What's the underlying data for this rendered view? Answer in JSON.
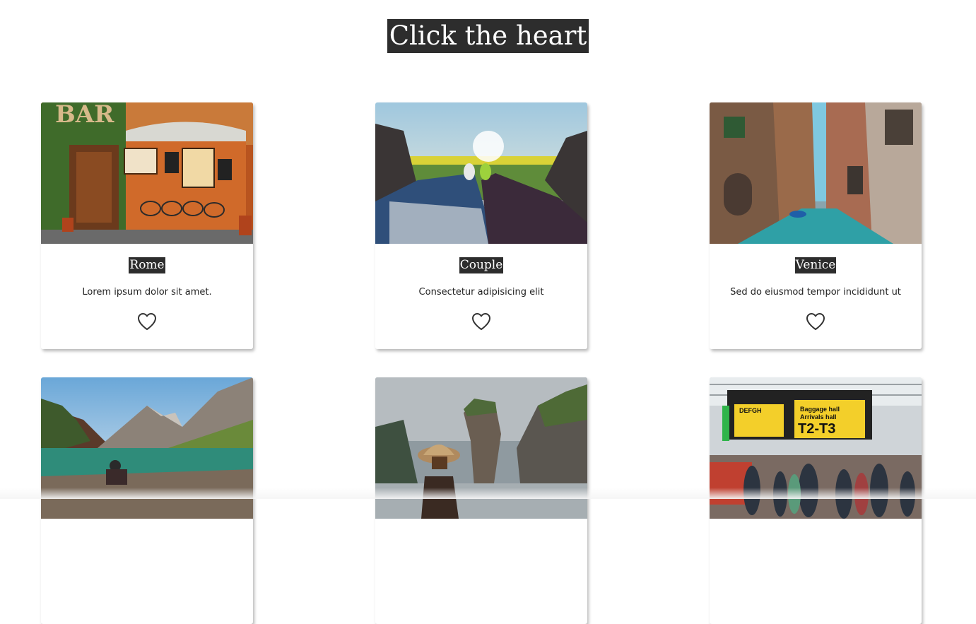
{
  "page": {
    "title": "Click the heart"
  },
  "cards": [
    {
      "name": "Rome",
      "description": "Lorem ipsum dolor sit amet.",
      "image": "rome-bar-photo",
      "liked": false
    },
    {
      "name": "Couple",
      "description": "Consectetur adipisicing elit",
      "image": "couple-feet-car-photo",
      "liked": false
    },
    {
      "name": "Venice",
      "description": "Sed do eiusmod tempor incididunt ut",
      "image": "venice-canal-photo",
      "liked": false
    },
    {
      "name": "",
      "description": "",
      "image": "mountain-lake-photo",
      "liked": false
    },
    {
      "name": "",
      "description": "",
      "image": "rock-island-photo",
      "liked": false
    },
    {
      "name": "",
      "description": "",
      "image": "airport-hall-photo",
      "liked": false
    }
  ],
  "colors": {
    "label_background": "#2d2d2d",
    "label_text": "#ffffff",
    "heart_stroke": "#333333"
  },
  "icons": {
    "heart": "heart-outline-icon"
  }
}
